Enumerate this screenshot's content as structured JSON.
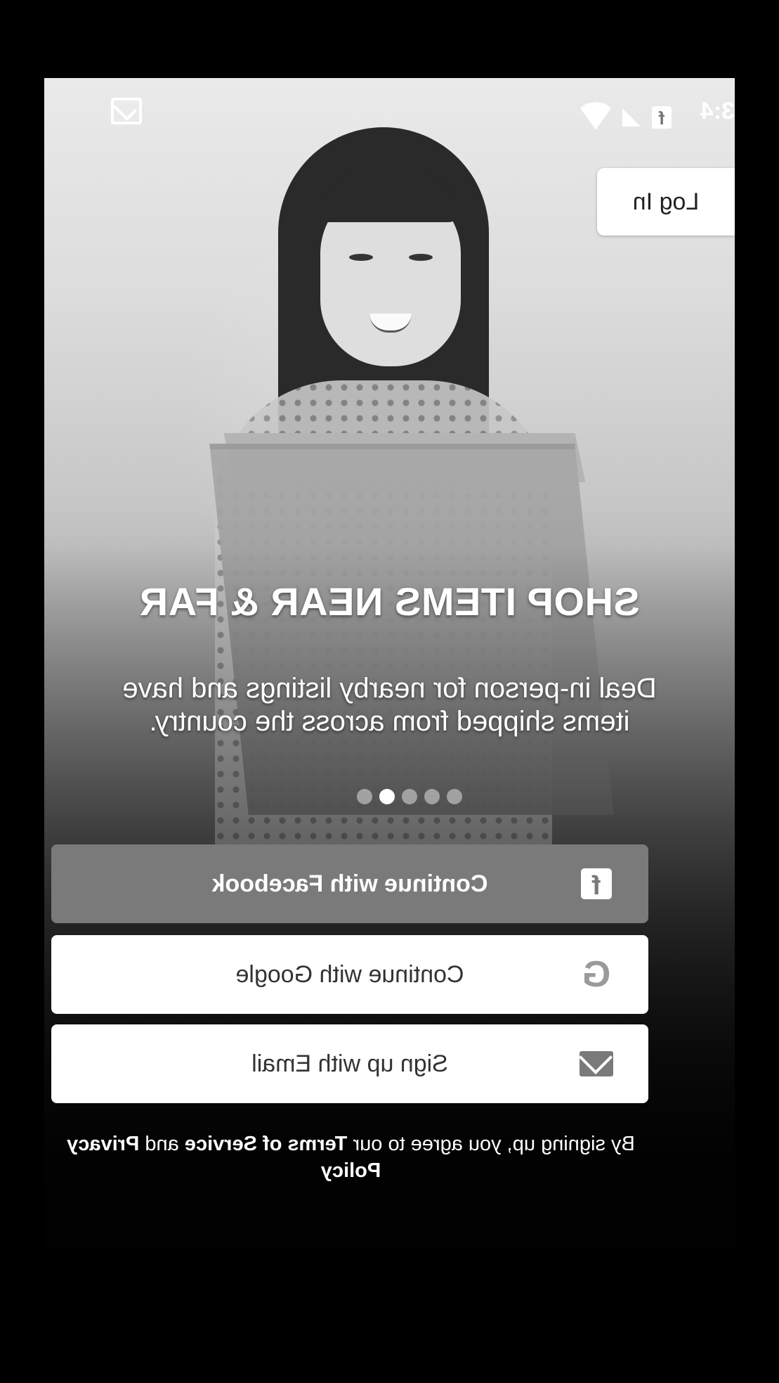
{
  "status_bar": {
    "time": "3:4"
  },
  "login": {
    "label": "Log In"
  },
  "hero": {
    "headline": "SHOP ITEMS NEAR & FAR",
    "subline": "Deal in-person for nearby listings and have items shipped from across the country."
  },
  "carousel": {
    "page_count": 5,
    "active_index": 1
  },
  "buttons": {
    "facebook": "Continue with Facebook",
    "google": "Continue with Google",
    "email": "Sign up with Email"
  },
  "terms": {
    "prefix": "By signing up, you agree to our ",
    "terms_link": "Terms of Service",
    "middle": " and ",
    "privacy_link": "Privacy Policy"
  },
  "colors": {
    "facebook_button": "#7a7a7a",
    "button_white": "#ffffff"
  },
  "icons": {
    "facebook": "facebook-icon",
    "google": "google-icon",
    "email": "mail-icon",
    "wifi": "wifi-icon",
    "signal": "signal-icon",
    "gmail": "gmail-icon"
  }
}
